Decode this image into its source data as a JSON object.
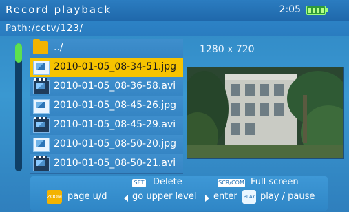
{
  "header": {
    "title": "Record playback",
    "time": "2:05",
    "battery_icon": "battery-full-icon"
  },
  "path": {
    "label": "Path:/cctv/123/"
  },
  "files": [
    {
      "name": "../",
      "icon": "folder-icon"
    },
    {
      "name": "2010-01-05_08-34-51.jpg",
      "icon": "image-icon",
      "selected": true
    },
    {
      "name": "2010-01-05_08-36-58.avi",
      "icon": "video-icon"
    },
    {
      "name": "2010-01-05_08-45-26.jpg",
      "icon": "image-icon"
    },
    {
      "name": "2010-01-05_08-45-29.avi",
      "icon": "video-icon"
    },
    {
      "name": "2010-01-05_08-50-20.jpg",
      "icon": "image-icon"
    },
    {
      "name": "2010-01-05_08-50-21.avi",
      "icon": "video-icon"
    }
  ],
  "preview": {
    "resolution": "1280 x 720"
  },
  "controls": {
    "set_key": "SET",
    "delete_label": "Delete",
    "scr_key": "SCR/COM",
    "fullscreen_label": "Full screen",
    "zoom_key": "ZOOM",
    "page_label": "page u/d",
    "upper_label": "go upper level",
    "enter_label": "enter",
    "play_key": "PLAY",
    "play_label": "play / pause"
  },
  "colors": {
    "accent": "#f7c300",
    "background": "#2f86c3",
    "battery": "#5ce14f"
  }
}
